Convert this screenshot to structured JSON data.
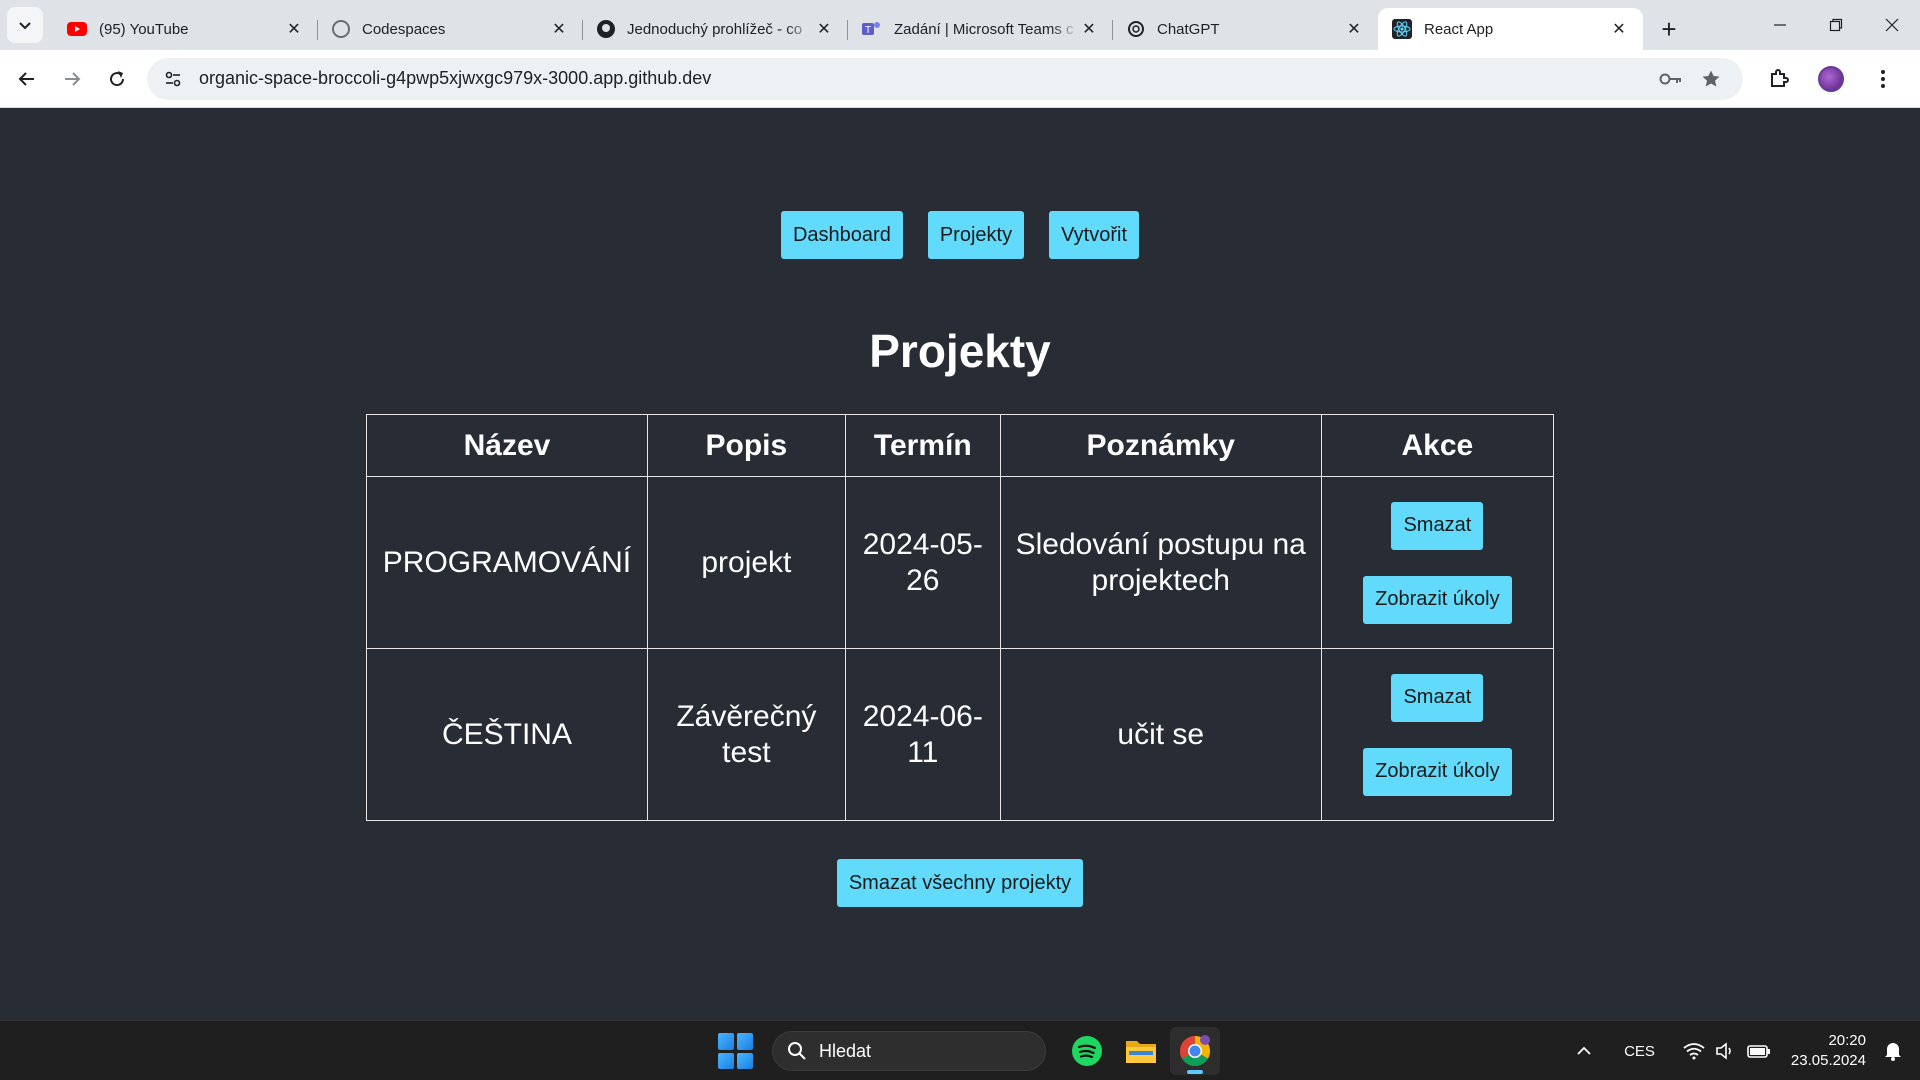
{
  "browser": {
    "tabs": [
      {
        "title": "(95) YouTube",
        "icon": "youtube-icon",
        "active": false
      },
      {
        "title": "Codespaces",
        "icon": "github-icon",
        "active": false
      },
      {
        "title": "Jednoduchý prohlížeč - co",
        "icon": "github-icon",
        "active": false
      },
      {
        "title": "Zadání | Microsoft Teams c",
        "icon": "teams-icon",
        "active": false
      },
      {
        "title": "ChatGPT",
        "icon": "chatgpt-icon",
        "active": false
      },
      {
        "title": "React App",
        "icon": "react-icon",
        "active": true
      }
    ],
    "url": "organic-space-broccoli-g4pwp5xjwxgc979x-3000.app.github.dev"
  },
  "nav": {
    "dashboard": "Dashboard",
    "projects": "Projekty",
    "create": "Vytvořit"
  },
  "page": {
    "title": "Projekty",
    "columns": [
      "Název",
      "Popis",
      "Termín",
      "Poznámky",
      "Akce"
    ],
    "rows": [
      {
        "name": "PROGRAMOVÁNÍ",
        "description": "projekt",
        "deadline": "2024-05-26",
        "notes": "Sledování postupu na projektech"
      },
      {
        "name": "ČEŠTINA",
        "description": "Závěrečný test",
        "deadline": "2024-06-11",
        "notes": "učit se"
      }
    ],
    "delete_label": "Smazat",
    "show_tasks_label": "Zobrazit úkoly",
    "delete_all_label": "Smazat všechny projekty"
  },
  "colors": {
    "background": "#282c34",
    "button": "#61dafb"
  },
  "taskbar": {
    "search_label": "Hledat",
    "language": "CES",
    "time": "20:20",
    "date": "23.05.2024"
  }
}
